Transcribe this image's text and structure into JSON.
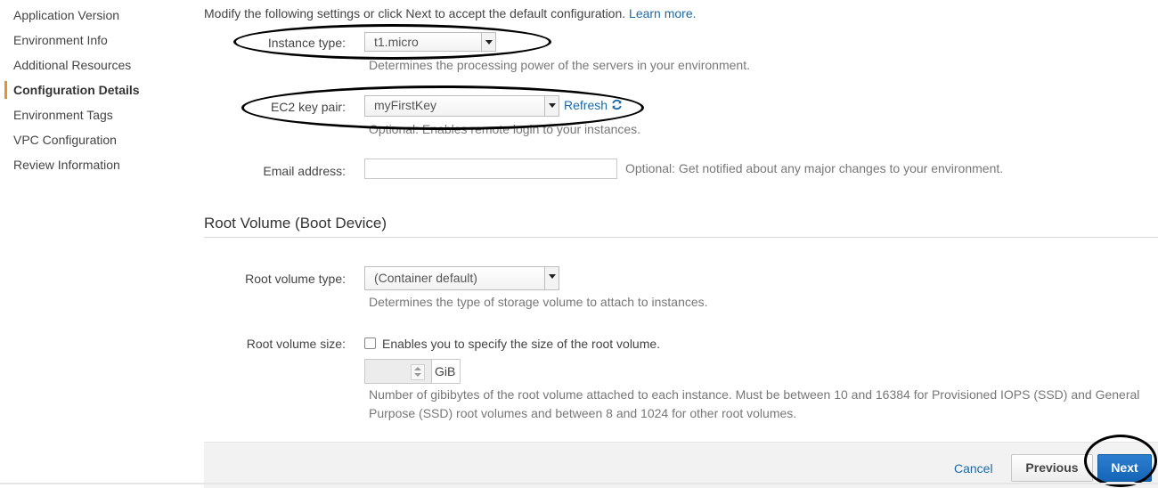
{
  "sidebar": {
    "items": [
      {
        "label": "Application Version",
        "active": false
      },
      {
        "label": "Environment Info",
        "active": false
      },
      {
        "label": "Additional Resources",
        "active": false
      },
      {
        "label": "Configuration Details",
        "active": true
      },
      {
        "label": "Environment Tags",
        "active": false
      },
      {
        "label": "VPC Configuration",
        "active": false
      },
      {
        "label": "Review Information",
        "active": false
      }
    ],
    "active_color": "#e8912e"
  },
  "intro": {
    "text": "Modify the following settings or click Next to accept the default configuration.",
    "link": "Learn more."
  },
  "instance_type": {
    "label": "Instance type:",
    "value": "t1.micro",
    "hint": "Determines the processing power of the servers in your environment."
  },
  "key_pair": {
    "label": "EC2 key pair:",
    "value": "myFirstKey",
    "refresh": "Refresh",
    "hint": "Optional: Enables remote login to your instances."
  },
  "email": {
    "label": "Email address:",
    "value": "",
    "hint": "Optional: Get notified about any major changes to your environment."
  },
  "root_volume": {
    "title": "Root Volume (Boot Device)",
    "type_label": "Root volume type:",
    "type_value": "(Container default)",
    "type_hint": "Determines the type of storage volume to attach to instances.",
    "size_label": "Root volume size:",
    "size_checkbox": "Enables you to specify the size of the root volume.",
    "size_unit": "GiB",
    "size_hint": "Number of gibibytes of the root volume attached to each instance. Must be between 10 and 16384 for Provisioned IOPS (SSD) and General Purpose (SSD) root volumes and between 8 and 1024 for other root volumes."
  },
  "footer": {
    "cancel": "Cancel",
    "previous": "Previous",
    "next": "Next"
  },
  "colors": {
    "link": "#1a6aa8",
    "primary_button": "#1f72c4",
    "annotation": "#000000"
  }
}
